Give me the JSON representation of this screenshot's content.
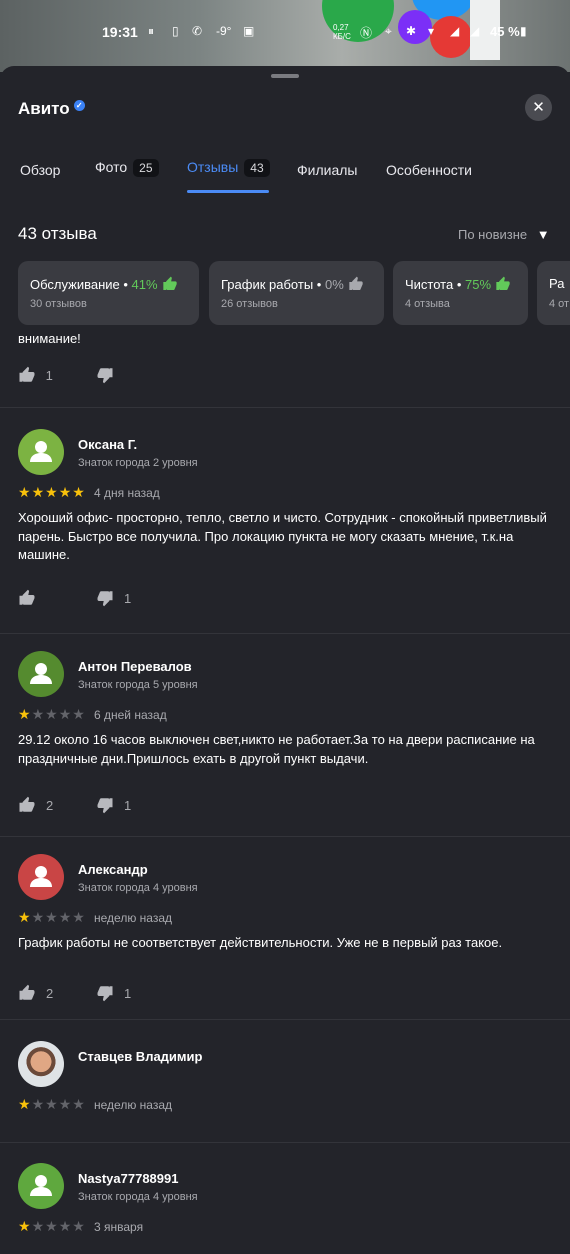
{
  "status_bar": {
    "time": "19:31",
    "temp": "-9°",
    "net": "0,27\nКБ/С",
    "battery": "45 %"
  },
  "header": {
    "title": "Авито"
  },
  "tabs": [
    {
      "label": "Обзор",
      "count": null
    },
    {
      "label": "Фото",
      "count": "25"
    },
    {
      "label": "Отзывы",
      "count": "43"
    },
    {
      "label": "Филиалы",
      "count": null
    },
    {
      "label": "Особенности",
      "count": null
    }
  ],
  "reviews_count_label": "43 отзыва",
  "sort_label": "По новизне",
  "aspects": [
    {
      "label": "Обслуживание",
      "pct": "41%",
      "sub": "30 отзывов"
    },
    {
      "label": "График работы",
      "pct": "0%",
      "sub": "26 отзывов"
    },
    {
      "label": "Чистота",
      "pct": "75%",
      "sub": "4 отзыва"
    },
    {
      "label": "Ра",
      "pct": "",
      "sub": "4 от"
    }
  ],
  "fragment": {
    "text": "внимание!",
    "likes": "1",
    "dislikes": ""
  },
  "reviews": [
    {
      "name": "Оксана Г.",
      "level": "Знаток города 2 уровня",
      "rating": 5,
      "date": "4 дня назад",
      "text": "Хороший офис- просторно, тепло, светло и чисто. Сотрудник - спокойный приветливый парень. Быстро все получила. Про локацию пункта не могу сказать мнение, т.к.на машине.",
      "likes": "",
      "dislikes": "1",
      "avatar_color": "#7cb342"
    },
    {
      "name": "Антон Перевалов",
      "level": "Знаток города 5 уровня",
      "rating": 1,
      "date": "6 дней назад",
      "text": "29.12 около 16 часов выключен свет,никто не работает.За то на двери расписание на праздничные дни.Пришлось ехать в другой пункт выдачи.",
      "likes": "2",
      "dislikes": "1",
      "avatar_color": "#558b2f"
    },
    {
      "name": "Александр",
      "level": "Знаток города 4 уровня",
      "rating": 1,
      "date": "неделю назад",
      "text": "График работы не соответствует действительности. Уже не в первый раз такое.",
      "likes": "2",
      "dislikes": "1",
      "avatar_color": "#c94545"
    },
    {
      "name": "Ставцев  Владимир",
      "level": "",
      "rating": 1,
      "date": "неделю назад",
      "text": "",
      "likes": "",
      "dislikes": "",
      "avatar_color": "photo"
    },
    {
      "name": "Nastya77788991",
      "level": "Знаток города 4 уровня",
      "rating": 1,
      "date": "3 января",
      "text": "",
      "likes": "",
      "dislikes": "",
      "avatar_color": "#5fa83e"
    }
  ]
}
